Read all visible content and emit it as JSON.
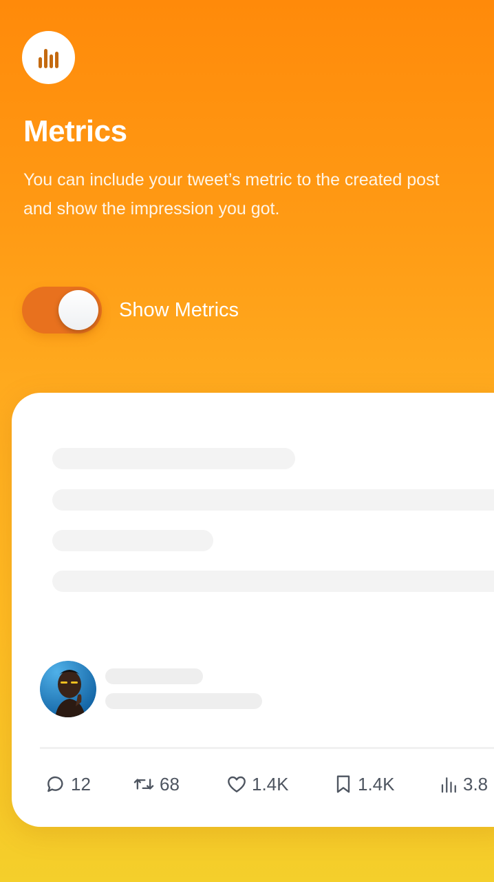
{
  "header": {
    "icon": "bar-chart-icon",
    "title": "Metrics",
    "description": "You can include your tweet’s metric to the created post and show the impression you got."
  },
  "toggle": {
    "label": "Show Metrics",
    "checked": true
  },
  "tweet": {
    "avatar": "profile-photo",
    "metrics": {
      "replies": "12",
      "retweets": "68",
      "likes": "1.4K",
      "bookmarks": "1.4K",
      "views": "3.8"
    }
  },
  "colors": {
    "gradient_top": "#ff8a0a",
    "gradient_bottom": "#f4cf2b",
    "toggle_track": "#e8711e",
    "icon_accent": "#c46a10"
  }
}
